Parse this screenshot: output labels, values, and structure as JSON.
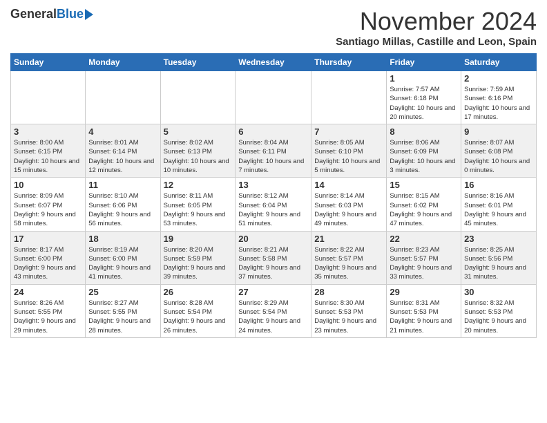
{
  "header": {
    "logo_general": "General",
    "logo_blue": "Blue",
    "month_title": "November 2024",
    "location": "Santiago Millas, Castille and Leon, Spain"
  },
  "calendar": {
    "headers": [
      "Sunday",
      "Monday",
      "Tuesday",
      "Wednesday",
      "Thursday",
      "Friday",
      "Saturday"
    ],
    "weeks": [
      [
        {
          "day": "",
          "info": ""
        },
        {
          "day": "",
          "info": ""
        },
        {
          "day": "",
          "info": ""
        },
        {
          "day": "",
          "info": ""
        },
        {
          "day": "",
          "info": ""
        },
        {
          "day": "1",
          "info": "Sunrise: 7:57 AM\nSunset: 6:18 PM\nDaylight: 10 hours and 20 minutes."
        },
        {
          "day": "2",
          "info": "Sunrise: 7:59 AM\nSunset: 6:16 PM\nDaylight: 10 hours and 17 minutes."
        }
      ],
      [
        {
          "day": "3",
          "info": "Sunrise: 8:00 AM\nSunset: 6:15 PM\nDaylight: 10 hours and 15 minutes."
        },
        {
          "day": "4",
          "info": "Sunrise: 8:01 AM\nSunset: 6:14 PM\nDaylight: 10 hours and 12 minutes."
        },
        {
          "day": "5",
          "info": "Sunrise: 8:02 AM\nSunset: 6:13 PM\nDaylight: 10 hours and 10 minutes."
        },
        {
          "day": "6",
          "info": "Sunrise: 8:04 AM\nSunset: 6:11 PM\nDaylight: 10 hours and 7 minutes."
        },
        {
          "day": "7",
          "info": "Sunrise: 8:05 AM\nSunset: 6:10 PM\nDaylight: 10 hours and 5 minutes."
        },
        {
          "day": "8",
          "info": "Sunrise: 8:06 AM\nSunset: 6:09 PM\nDaylight: 10 hours and 3 minutes."
        },
        {
          "day": "9",
          "info": "Sunrise: 8:07 AM\nSunset: 6:08 PM\nDaylight: 10 hours and 0 minutes."
        }
      ],
      [
        {
          "day": "10",
          "info": "Sunrise: 8:09 AM\nSunset: 6:07 PM\nDaylight: 9 hours and 58 minutes."
        },
        {
          "day": "11",
          "info": "Sunrise: 8:10 AM\nSunset: 6:06 PM\nDaylight: 9 hours and 56 minutes."
        },
        {
          "day": "12",
          "info": "Sunrise: 8:11 AM\nSunset: 6:05 PM\nDaylight: 9 hours and 53 minutes."
        },
        {
          "day": "13",
          "info": "Sunrise: 8:12 AM\nSunset: 6:04 PM\nDaylight: 9 hours and 51 minutes."
        },
        {
          "day": "14",
          "info": "Sunrise: 8:14 AM\nSunset: 6:03 PM\nDaylight: 9 hours and 49 minutes."
        },
        {
          "day": "15",
          "info": "Sunrise: 8:15 AM\nSunset: 6:02 PM\nDaylight: 9 hours and 47 minutes."
        },
        {
          "day": "16",
          "info": "Sunrise: 8:16 AM\nSunset: 6:01 PM\nDaylight: 9 hours and 45 minutes."
        }
      ],
      [
        {
          "day": "17",
          "info": "Sunrise: 8:17 AM\nSunset: 6:00 PM\nDaylight: 9 hours and 43 minutes."
        },
        {
          "day": "18",
          "info": "Sunrise: 8:19 AM\nSunset: 6:00 PM\nDaylight: 9 hours and 41 minutes."
        },
        {
          "day": "19",
          "info": "Sunrise: 8:20 AM\nSunset: 5:59 PM\nDaylight: 9 hours and 39 minutes."
        },
        {
          "day": "20",
          "info": "Sunrise: 8:21 AM\nSunset: 5:58 PM\nDaylight: 9 hours and 37 minutes."
        },
        {
          "day": "21",
          "info": "Sunrise: 8:22 AM\nSunset: 5:57 PM\nDaylight: 9 hours and 35 minutes."
        },
        {
          "day": "22",
          "info": "Sunrise: 8:23 AM\nSunset: 5:57 PM\nDaylight: 9 hours and 33 minutes."
        },
        {
          "day": "23",
          "info": "Sunrise: 8:25 AM\nSunset: 5:56 PM\nDaylight: 9 hours and 31 minutes."
        }
      ],
      [
        {
          "day": "24",
          "info": "Sunrise: 8:26 AM\nSunset: 5:55 PM\nDaylight: 9 hours and 29 minutes."
        },
        {
          "day": "25",
          "info": "Sunrise: 8:27 AM\nSunset: 5:55 PM\nDaylight: 9 hours and 28 minutes."
        },
        {
          "day": "26",
          "info": "Sunrise: 8:28 AM\nSunset: 5:54 PM\nDaylight: 9 hours and 26 minutes."
        },
        {
          "day": "27",
          "info": "Sunrise: 8:29 AM\nSunset: 5:54 PM\nDaylight: 9 hours and 24 minutes."
        },
        {
          "day": "28",
          "info": "Sunrise: 8:30 AM\nSunset: 5:53 PM\nDaylight: 9 hours and 23 minutes."
        },
        {
          "day": "29",
          "info": "Sunrise: 8:31 AM\nSunset: 5:53 PM\nDaylight: 9 hours and 21 minutes."
        },
        {
          "day": "30",
          "info": "Sunrise: 8:32 AM\nSunset: 5:53 PM\nDaylight: 9 hours and 20 minutes."
        }
      ]
    ]
  }
}
